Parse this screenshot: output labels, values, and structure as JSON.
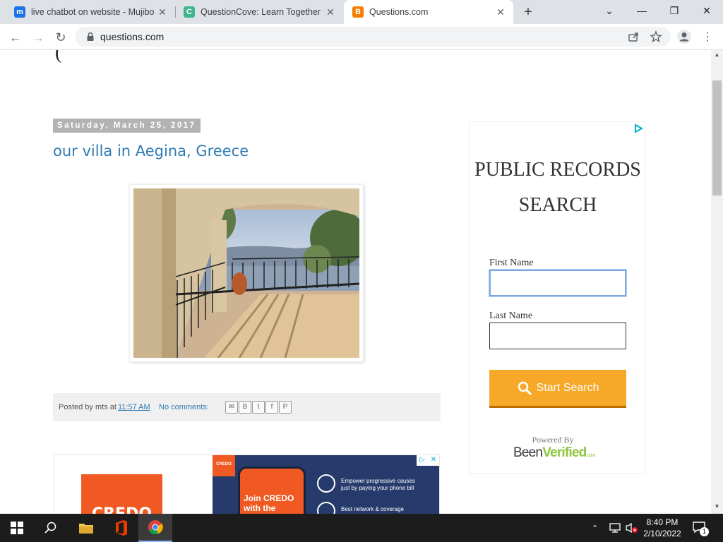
{
  "browser": {
    "tabs": [
      {
        "title": "live chatbot on website - Mujibo",
        "favicon": "m",
        "favicon_color": "#1a73e8"
      },
      {
        "title": "QuestionCove: Learn Together",
        "favicon": "C",
        "favicon_color": "#3fb68b"
      },
      {
        "title": "Questions.com",
        "favicon": "B",
        "favicon_color": "#f57d00",
        "active": true
      }
    ],
    "new_tab_label": "+",
    "url": "questions.com"
  },
  "post": {
    "date": "Saturday, March 25, 2017",
    "title": "our villa in Aegina, Greece",
    "footer": {
      "posted_by": "Posted by mts at",
      "time": "11:57 AM",
      "comments": "No comments:"
    },
    "share_icons": [
      "email-icon",
      "blogger-icon",
      "twitter-icon",
      "facebook-icon",
      "pinterest-icon"
    ]
  },
  "ad_bottom": {
    "logo_text": "CREDO",
    "small_logo": "CREDO",
    "phone_text": "Join CREDO with the",
    "line1": "Empower progressive causes",
    "line1b": "just by paying your phone bill",
    "line2": "Best network & coverage"
  },
  "side_ad": {
    "title_line1": "PUBLIC RECORDS",
    "title_line2": "SEARCH",
    "first_name_label": "First Name",
    "first_name_value": "",
    "last_name_label": "Last Name",
    "last_name_value": "",
    "search_button": "Start Search",
    "powered_by": "Powered By",
    "brand_part1": "Been",
    "brand_part2": "Verified",
    "brand_suffix": ".com",
    "brand_color1": "#3a3a3a",
    "brand_color2": "#8dc63f"
  },
  "taskbar": {
    "time": "8:40 PM",
    "date": "2/10/2022",
    "notification_count": "1"
  }
}
